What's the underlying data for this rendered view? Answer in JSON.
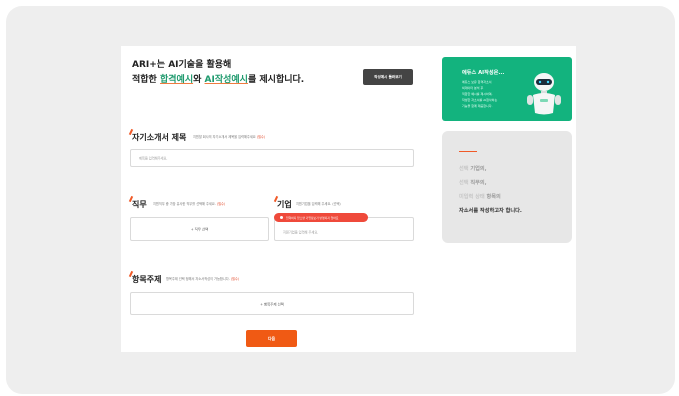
{
  "hero": {
    "line1": "ARI+는 AI기술을 활용해",
    "line2_prefix": "적합한 ",
    "line2_highlight1": "합격예시",
    "line2_mid": "와 ",
    "line2_highlight2": "AI작성예시",
    "line2_suffix": "를 제시합니다.",
    "example_button": "작성예시 둘러보기"
  },
  "sections": {
    "self_intro": {
      "title": "자기소개서 제목",
      "hint": "지원할 회사의 자기소개서 제목을 입력해주세요",
      "required": "(필수)",
      "placeholder": "제목을 입력해주세요."
    },
    "job": {
      "title": "직무",
      "hint": "지원직무 중 가장 유사한 직무를 선택해 주세요.",
      "required": "(필수)",
      "select_label": "+ 직무 선택"
    },
    "company": {
      "title": "기업",
      "hint": "지원기업을 입력해 주세요.",
      "optional": "(선택)",
      "notice": "입력하지 않으면 기업정보가 반영되지 않아요",
      "placeholder": "지원기업을 입력해 주세요."
    },
    "topic": {
      "title": "항목주제",
      "hint": "항목주제 선택 정해서 자소서작성이 가능합니다.",
      "required": "(필수)",
      "select_label": "+ 항목주제 선택"
    }
  },
  "next_button": "다음",
  "green_card": {
    "title": "에듀스 AI작성은...",
    "lines": [
      "에듀스 보유 합격자소서",
      "빅데이터 분석 후",
      "적합한 예시를 제시하며,",
      "작성한 자소서를 AI첨삭하는",
      "기능을 함께 제공합니다."
    ]
  },
  "gray_card": {
    "line1_a": "선택",
    "line1_b": "기업의,",
    "line2_a": "선택",
    "line2_b": "직무의,",
    "line3_a": "미입력 상태",
    "line3_b": "항목의",
    "line4": "자소서를 작성하고자 합니다."
  },
  "colors": {
    "accent_orange": "#f05a14",
    "brand_green": "#13b37e",
    "notice_red": "#ef4a3b"
  }
}
